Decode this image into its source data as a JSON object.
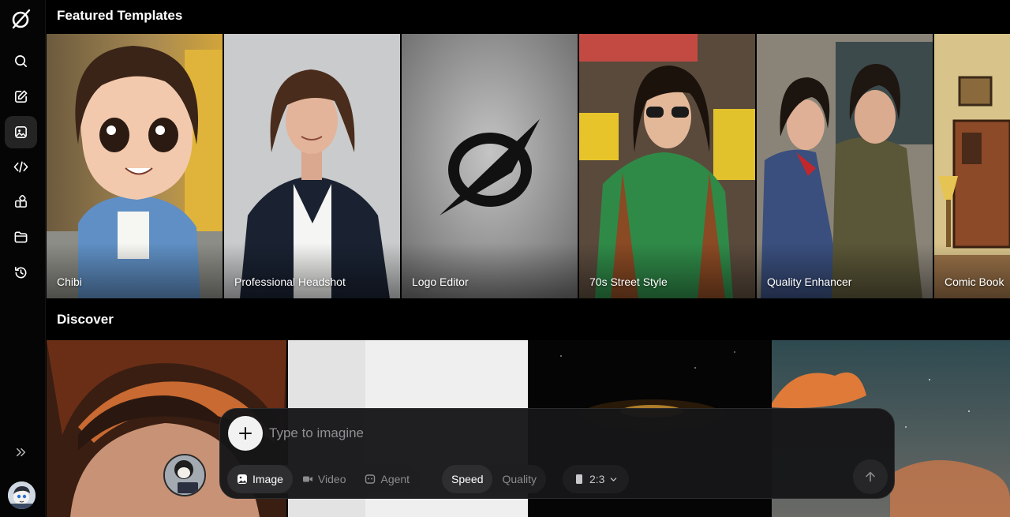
{
  "sections": {
    "featured_title": "Featured Templates",
    "discover_title": "Discover"
  },
  "templates": [
    {
      "label": "Chibi"
    },
    {
      "label": "Professional Headshot"
    },
    {
      "label": "Logo Editor"
    },
    {
      "label": "70s Street Style"
    },
    {
      "label": "Quality Enhancer"
    },
    {
      "label": "Comic Book"
    }
  ],
  "sidebar": {
    "items": [
      {
        "icon": "search-icon"
      },
      {
        "icon": "edit-icon"
      },
      {
        "icon": "image-gallery-icon",
        "active": true
      },
      {
        "icon": "code-icon"
      },
      {
        "icon": "apps-icon"
      },
      {
        "icon": "folder-icon"
      },
      {
        "icon": "history-icon"
      }
    ],
    "expand_icon": "double-chevron-right-icon"
  },
  "prompt": {
    "placeholder": "Type to imagine",
    "modes": [
      {
        "label": "Image",
        "selected": true
      },
      {
        "label": "Video",
        "selected": false
      },
      {
        "label": "Agent",
        "selected": false
      }
    ],
    "quality": [
      {
        "label": "Speed",
        "selected": true
      },
      {
        "label": "Quality",
        "selected": false
      }
    ],
    "aspect_ratio": "2:3"
  },
  "colors": {
    "background": "#000000",
    "prompt_bg": "#161618",
    "active_nav": "#242424"
  }
}
